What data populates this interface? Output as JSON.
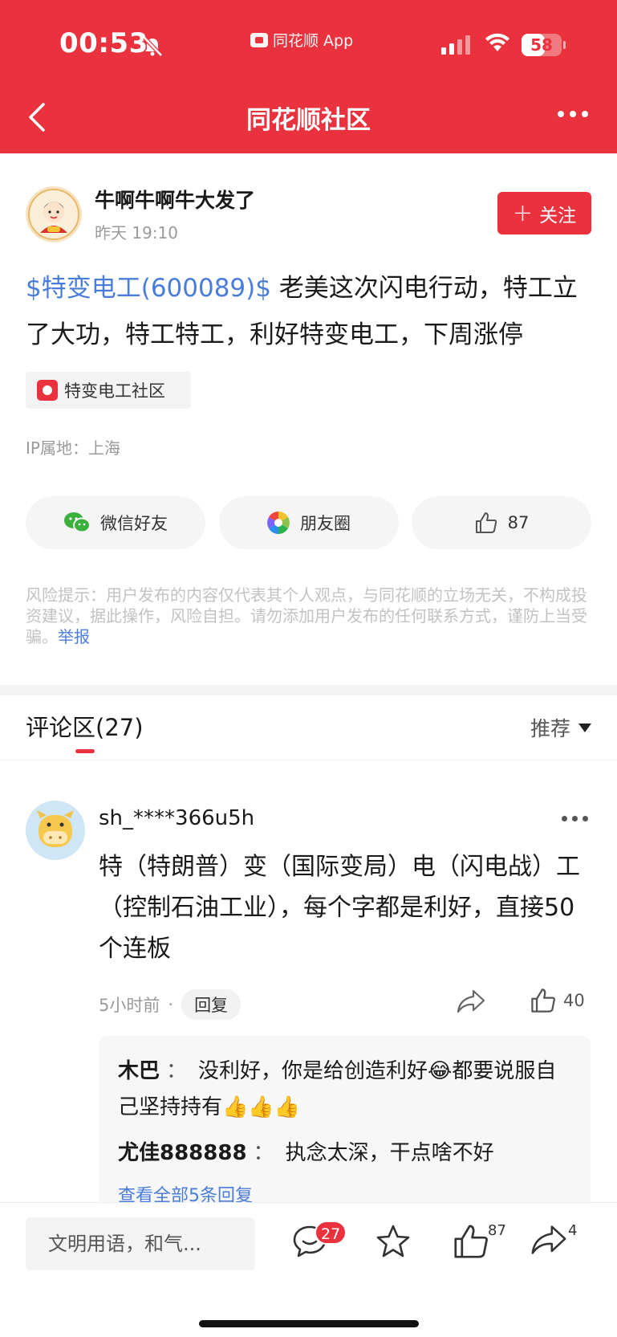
{
  "status_bar": {
    "time": "00:53",
    "app_label": "同花顺 App",
    "battery": "58",
    "battery_level": 0.58
  },
  "nav": {
    "title": "同花顺社区"
  },
  "post": {
    "author": "牛啊牛啊牛大发了",
    "time": "昨天 19:10",
    "follow_label": "关注",
    "stock_tag": "$特变电工(600089)$",
    "text": " 老美这次闪电行动，特工立了大功，特工特工，利好特变电工，下周涨停",
    "topic": "特变电工社区",
    "ip": "IP属地：上海",
    "share_wechat": "微信好友",
    "share_moments": "朋友圈",
    "likes": "87",
    "risk_text": "风险提示：用户发布的内容仅代表其个人观点，与同花顺的立场无关，不构成投资建议，据此操作，风险自担。请勿添加用户发布的任何联系方式，谨防上当受骗。",
    "report_label": "举报"
  },
  "comments": {
    "title": "评论区(27)",
    "sort_label": "推荐",
    "items": [
      {
        "user": "sh_****366u5h",
        "text": "特（特朗普）变（国际变局）电（闪电战）工（控制石油工业），每个字都是利好，直接50个连板",
        "time": "5小时前",
        "dot": "·",
        "reply_label": "回复",
        "likes": "40",
        "replies": [
          {
            "name": "木巴",
            "sep": "：",
            "text": "没利好，你是给创造利好😂都要说服自己坚持持有👍👍👍"
          },
          {
            "name": "尤佳888888",
            "sep": "：",
            "text": "执念太深，干点啥不好"
          }
        ],
        "view_all": "查看全部5条回复"
      }
    ]
  },
  "bottom_bar": {
    "input_placeholder": "文明用语，和气...",
    "comment_count": "27",
    "like_count": "87",
    "share_count": "4"
  },
  "colors": {
    "brand_red": "#e9323d",
    "link_blue": "#4a7ddb"
  },
  "icons": [
    "bell-slash-icon",
    "signal-icon",
    "wifi-icon",
    "battery-icon",
    "back-arrow-icon",
    "more-icon",
    "wechat-icon",
    "moments-icon",
    "thumbs-up-icon",
    "share-icon",
    "comment-icon",
    "star-icon"
  ]
}
